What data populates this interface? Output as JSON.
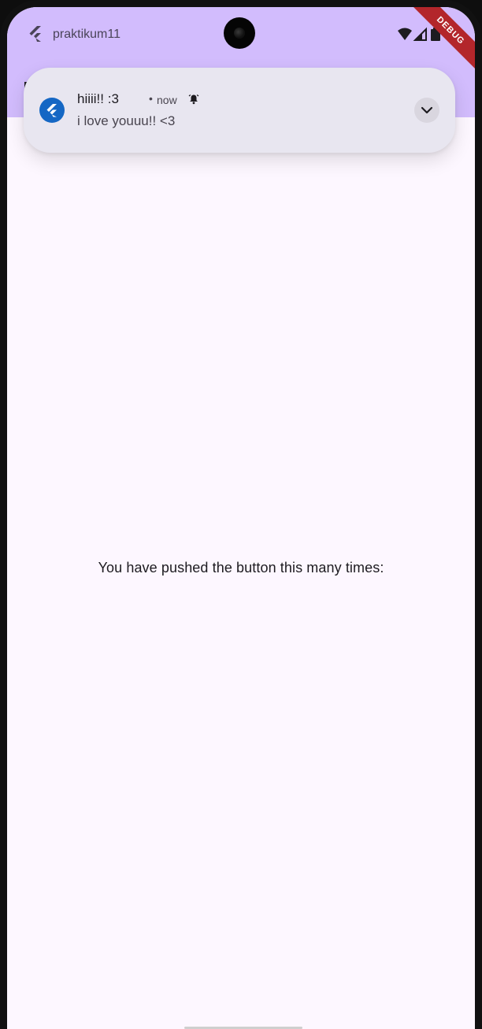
{
  "status_bar": {
    "app_name": "praktikum11",
    "icons": [
      "flutter-icon",
      "wifi-icon",
      "cellular-signal-icon",
      "battery-icon"
    ]
  },
  "debug_banner": {
    "label": "DEBUG"
  },
  "notification": {
    "title": "hiiii!! :3",
    "separator": "•",
    "time": "now",
    "body": "i love youuu!! <3",
    "icons": [
      "flutter-app-icon",
      "alarm-bell-icon",
      "chevron-down-icon"
    ]
  },
  "main": {
    "counter_label": "You have pushed the button this many times:"
  },
  "colors": {
    "app_bar": "#d2bcfd",
    "background": "#fdf7ff",
    "notification_bg": "#e8e6f0",
    "notification_icon": "#1567c4",
    "debug_ribbon": "#b3262b"
  }
}
